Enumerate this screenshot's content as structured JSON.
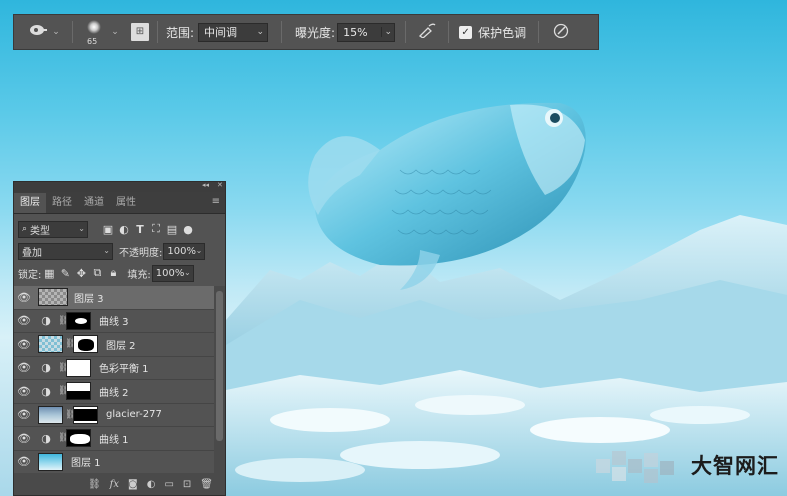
{
  "options_bar": {
    "tool_icon": "dodge-tool-icon",
    "brush_size": "65",
    "range_label": "范围:",
    "range_value": "中间调",
    "exposure_label": "曝光度:",
    "exposure_value": "15%",
    "protect_tones_label": "保护色调",
    "protect_tones_checked": true
  },
  "layers_panel": {
    "tabs": [
      {
        "label": "图层",
        "active": true
      },
      {
        "label": "路径",
        "active": false
      },
      {
        "label": "通道",
        "active": false
      },
      {
        "label": "属性",
        "active": false
      }
    ],
    "filter_label": "类型",
    "blend_mode": "叠加",
    "opacity_label": "不透明度:",
    "opacity_value": "100%",
    "lock_label": "锁定:",
    "fill_label": "填充:",
    "fill_value": "100%",
    "layers": [
      {
        "name": "图层 3",
        "type": "pixel",
        "selected": true
      },
      {
        "name": "曲线 3",
        "type": "curves",
        "selected": false
      },
      {
        "name": "图层 2",
        "type": "pixel-mask",
        "selected": false
      },
      {
        "name": "色彩平衡 1",
        "type": "color-balance",
        "selected": false
      },
      {
        "name": "曲线 2",
        "type": "curves",
        "selected": false
      },
      {
        "name": "glacier-277",
        "type": "pixel-mask",
        "selected": false
      },
      {
        "name": "曲线 1",
        "type": "curves",
        "selected": false
      },
      {
        "name": "图层 1",
        "type": "pixel",
        "selected": false
      }
    ],
    "bottom_icons": [
      "link-icon",
      "fx-icon",
      "add-mask-icon",
      "adjustment-icon",
      "group-icon",
      "new-layer-icon",
      "delete-icon"
    ],
    "bottom_fx": "fx"
  },
  "watermark": "大智网汇"
}
